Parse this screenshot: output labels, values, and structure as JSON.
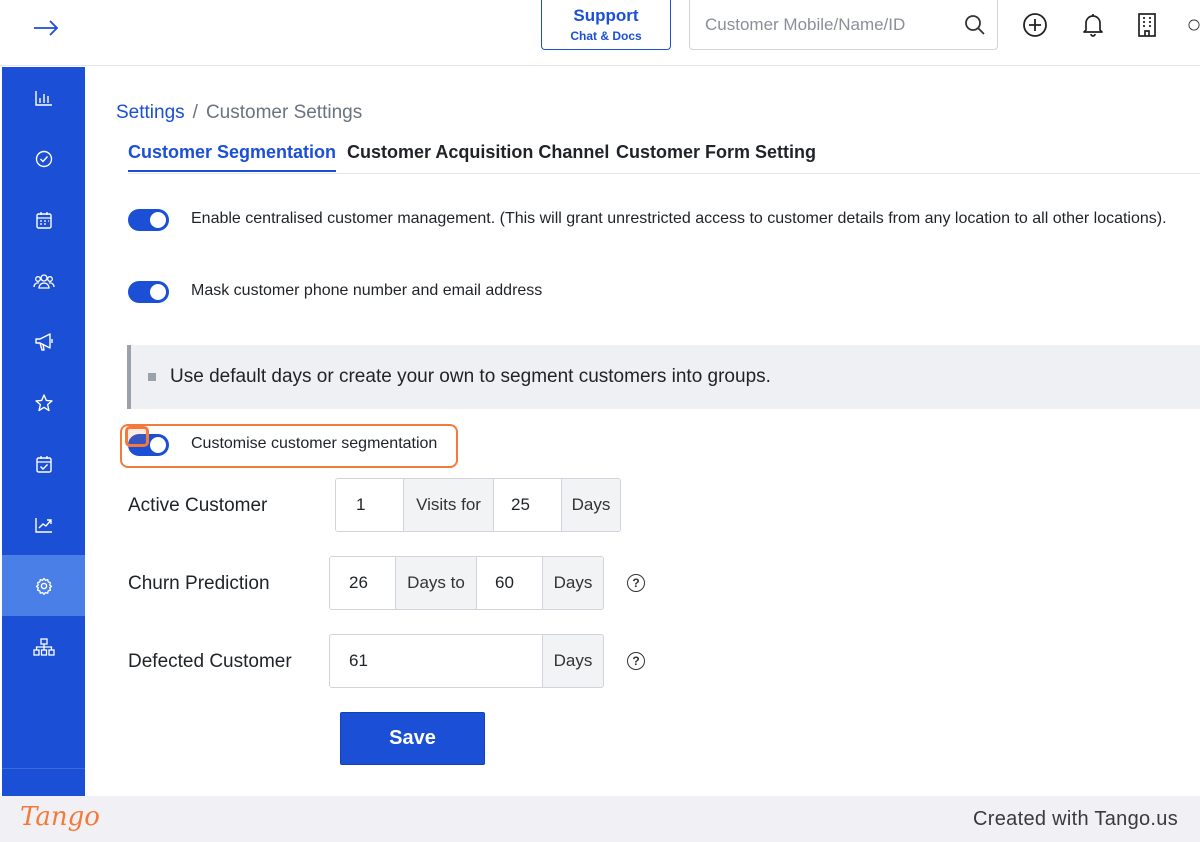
{
  "header": {
    "support": {
      "title": "Support",
      "subtitle": "Chat & Docs"
    },
    "search": {
      "placeholder": "Customer Mobile/Name/ID"
    },
    "icons": [
      "arrow-right-icon",
      "search-icon",
      "plus-circle-icon",
      "bell-icon",
      "building-icon"
    ]
  },
  "sidebar": {
    "items": [
      {
        "icon": "bar-chart-icon"
      },
      {
        "icon": "check-circle-icon"
      },
      {
        "icon": "calendar-icon"
      },
      {
        "icon": "users-icon"
      },
      {
        "icon": "megaphone-icon"
      },
      {
        "icon": "star-icon"
      },
      {
        "icon": "calendar-check-icon"
      },
      {
        "icon": "trend-chart-icon"
      },
      {
        "icon": "gear-icon",
        "active": true
      },
      {
        "icon": "org-chart-icon"
      }
    ]
  },
  "breadcrumb": {
    "parent": "Settings",
    "separator": "/",
    "current": "Customer Settings"
  },
  "tabs": [
    {
      "label": "Customer Segmentation",
      "active": true
    },
    {
      "label": "Customer Acquisition Channel",
      "active": false
    },
    {
      "label": "Customer Form Setting",
      "active": false
    }
  ],
  "settings": {
    "centralised_label": "Enable centralised customer management. (This will grant unrestricted access to customer details from any location to all other locations).",
    "centralised_on": true,
    "mask_label": "Mask customer phone number and email address",
    "mask_on": true,
    "info_text": "Use default days or create your own to segment customers into groups.",
    "customise_label": "Customise customer segmentation",
    "customise_on": true
  },
  "segments": {
    "active": {
      "label": "Active Customer",
      "visits": "1",
      "visits_addon": "Visits for",
      "days": "25",
      "days_addon": "Days"
    },
    "churn": {
      "label": "Churn Prediction",
      "from": "26",
      "from_addon": "Days to",
      "to": "60",
      "to_addon": "Days",
      "help": "?"
    },
    "defected": {
      "label": "Defected Customer",
      "days": "61",
      "days_addon": "Days",
      "help": "?"
    }
  },
  "save_label": "Save",
  "footer": {
    "logo": "Tango",
    "credit": "Created with Tango.us"
  },
  "colors": {
    "primary": "#1a4fd6",
    "sidebar_active": "#4a7fe8",
    "highlight": "#f47a3a"
  }
}
